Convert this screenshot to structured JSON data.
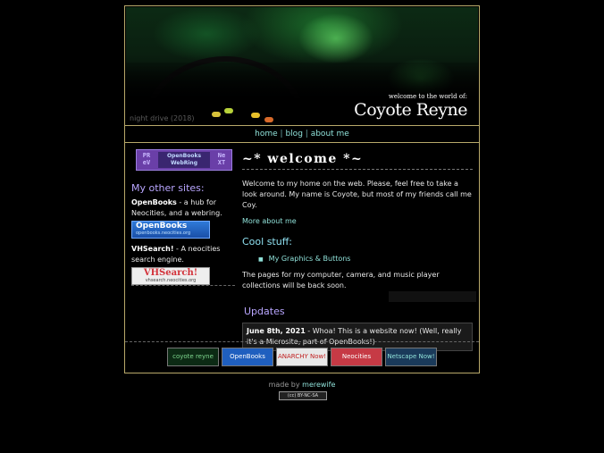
{
  "banner": {
    "caption": "night drive (2018)",
    "welcome": "welcome to the      world of:",
    "name": "Coyote Reyne"
  },
  "nav": {
    "items": [
      "home",
      "blog",
      "about me"
    ],
    "separator": "|"
  },
  "sidebar": {
    "webring": {
      "prev": "PR eV",
      "title": "OpenBooks WebRing",
      "next": "Ne XT"
    },
    "heading": "My other sites:",
    "sites": [
      {
        "name": "OpenBooks",
        "desc": " - a hub for Neocities, and a webring.",
        "banner_title": "OpenBooks",
        "banner_sub": "openbooks.neocities.org"
      },
      {
        "name": "VHSearch!",
        "desc": " - A neocities search engine.",
        "banner_title": "VHSearch!",
        "banner_sub": "vhsearch.neocities.org"
      }
    ]
  },
  "main": {
    "welcome_title": "~* welcome *~",
    "welcome_text": "Welcome to my home on the web. Please, feel free to take a look around. My name is Coyote, but most of my friends call me Coy.",
    "more_link": "More about me",
    "cool_title": "Cool stuff:",
    "cool_items": [
      "My Graphics & Buttons"
    ],
    "pages_text": "The pages for my computer, camera, and music player collections will be back soon.",
    "updates_title": "Updates",
    "updates": [
      {
        "date": "June 8th, 2021",
        "text": " - Whoa! This is a website now! (Well, really it's a Microsite, part of OpenBooks!)"
      }
    ]
  },
  "badges": [
    {
      "label": "coyote reyne",
      "color": "#0c2a14",
      "text_color": "#7fd88f"
    },
    {
      "label": "OpenBooks",
      "color": "#1f5fbf",
      "text_color": "#ffffff"
    },
    {
      "label": "ANARCHY Now!",
      "color": "#e8e8e8",
      "text_color": "#c02020"
    },
    {
      "label": "Neocities",
      "color": "#c63a45",
      "text_color": "#ffffff"
    },
    {
      "label": "Netscape Now!",
      "color": "#1a3a5a",
      "text_color": "#8fe0d8"
    }
  ],
  "footer": {
    "made_by": "made by ",
    "author": "merewife",
    "cc": "(cc) BY-NC-SA"
  },
  "colors": {
    "accent": "#8fe0d8",
    "heading_purple": "#b9a6ff",
    "frame_border": "#b8a96a"
  }
}
